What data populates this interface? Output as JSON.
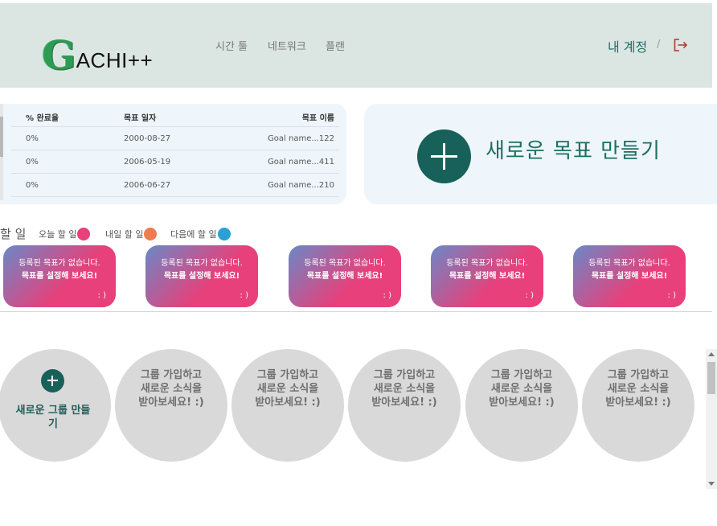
{
  "header": {
    "logo": "GACHI++",
    "nav": [
      "시간 툴",
      "네트워크",
      "플랜"
    ],
    "account_label": "내 계정",
    "separator": "/"
  },
  "goals_table": {
    "columns": [
      "% 완료율",
      "목표 일자",
      "목표 이름"
    ],
    "rows": [
      {
        "pct": "0%",
        "date": "2000-08-27",
        "name": "Goal name...122"
      },
      {
        "pct": "0%",
        "date": "2006-05-19",
        "name": "Goal name...411"
      },
      {
        "pct": "0%",
        "date": "2006-06-27",
        "name": "Goal name...210"
      }
    ]
  },
  "new_goal": {
    "label": "새로운 목표 만들기"
  },
  "todo": {
    "title": "할 일",
    "legend": [
      {
        "label": "오늘 할 일",
        "color": "#e8407a"
      },
      {
        "label": "내일 할 일",
        "color": "#ef7c4e"
      },
      {
        "label": "다음에 할 일",
        "color": "#2a9fd8"
      }
    ],
    "cards": [
      {
        "line1": "등록된 목표가 없습니다.",
        "line2": "목표를 설정해 보세요!",
        "smile": ": )"
      },
      {
        "line1": "등록된 목표가 없습니다.",
        "line2": "목표를 설정해 보세요!",
        "smile": ": )"
      },
      {
        "line1": "등록된 목표가 없습니다.",
        "line2": "목표를 설정해 보세요!",
        "smile": ": )"
      },
      {
        "line1": "등록된 목표가 없습니다.",
        "line2": "목표를 설정해 보세요!",
        "smile": ": )"
      },
      {
        "line1": "등록된 목표가 없습니다.",
        "line2": "목표를 설정해 보세요!",
        "smile": ": )"
      }
    ]
  },
  "groups": {
    "new_group_label": "새로운 그룹 만들기",
    "placeholder": [
      "그룹 가입하고",
      "새로운 소식을",
      "받아보세요! :)"
    ]
  },
  "colors": {
    "accent": "#17615a",
    "header_bg": "#dbe6e3",
    "panel_bg": "#eef6fb"
  }
}
